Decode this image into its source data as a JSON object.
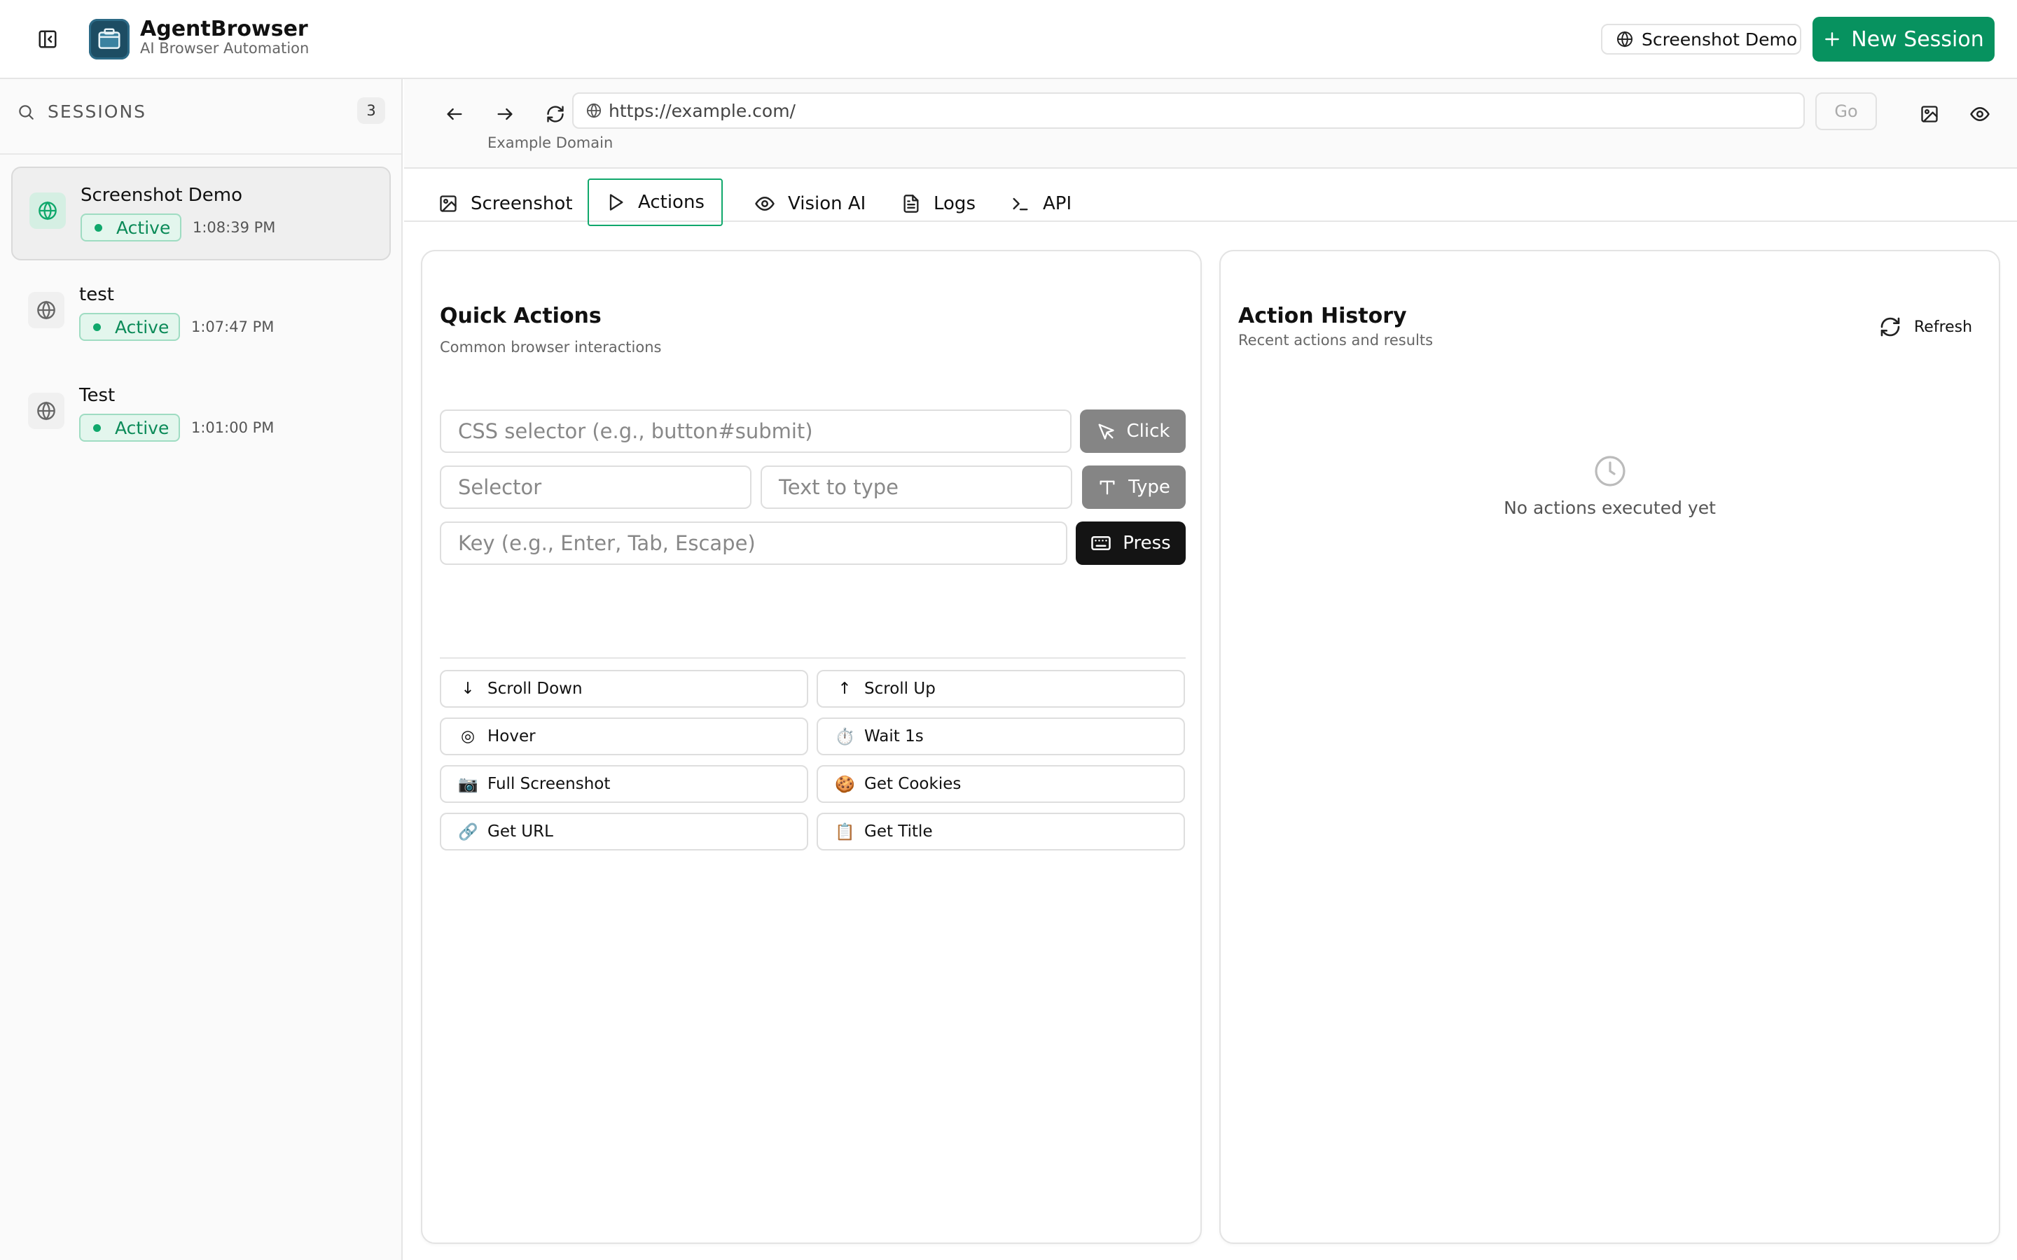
{
  "app": {
    "title": "AgentBrowser",
    "subtitle": "AI Browser Automation",
    "accent_color": "#07925f"
  },
  "header": {
    "current_session": "Screenshot Demo",
    "new_session_label": "New Session",
    "icons": [
      "sidebar-collapse-icon",
      "globe-icon",
      "plus-icon"
    ]
  },
  "sidebar": {
    "search_label": "SESSIONS",
    "count": "3",
    "sessions": [
      {
        "name": "Screenshot Demo",
        "status": "Active",
        "time": "1:08:39 PM",
        "selected": true
      },
      {
        "name": "test",
        "status": "Active",
        "time": "1:07:47 PM",
        "selected": false
      },
      {
        "name": "Test",
        "status": "Active",
        "time": "1:01:00 PM",
        "selected": false
      }
    ]
  },
  "browser": {
    "url": "https://example.com/",
    "go_label": "Go",
    "page_title": "Example Domain"
  },
  "tabs": [
    {
      "label": "Screenshot",
      "icon": "image-icon"
    },
    {
      "label": "Actions",
      "icon": "play-icon",
      "active": true
    },
    {
      "label": "Vision AI",
      "icon": "eye-icon"
    },
    {
      "label": "Logs",
      "icon": "file-text-icon"
    },
    {
      "label": "API",
      "icon": "terminal-icon"
    }
  ],
  "quick_actions": {
    "title": "Quick Actions",
    "subtitle": "Common browser interactions",
    "click_placeholder": "CSS selector (e.g., button#submit)",
    "click_label": "Click",
    "type_selector_placeholder": "Selector",
    "type_text_placeholder": "Text to type",
    "type_label": "Type",
    "key_placeholder": "Key (e.g., Enter, Tab, Escape)",
    "press_label": "Press",
    "buttons": [
      {
        "icon": "↓",
        "label": "Scroll Down"
      },
      {
        "icon": "↑",
        "label": "Scroll Up"
      },
      {
        "icon": "◎",
        "label": "Hover"
      },
      {
        "icon": "⏱️",
        "label": "Wait 1s"
      },
      {
        "icon": "📷",
        "label": "Full Screenshot"
      },
      {
        "icon": "🍪",
        "label": "Get Cookies"
      },
      {
        "icon": "🔗",
        "label": "Get URL"
      },
      {
        "icon": "📋",
        "label": "Get Title"
      }
    ]
  },
  "action_history": {
    "title": "Action History",
    "subtitle": "Recent actions and results",
    "refresh_label": "Refresh",
    "empty_text": "No actions executed yet"
  }
}
